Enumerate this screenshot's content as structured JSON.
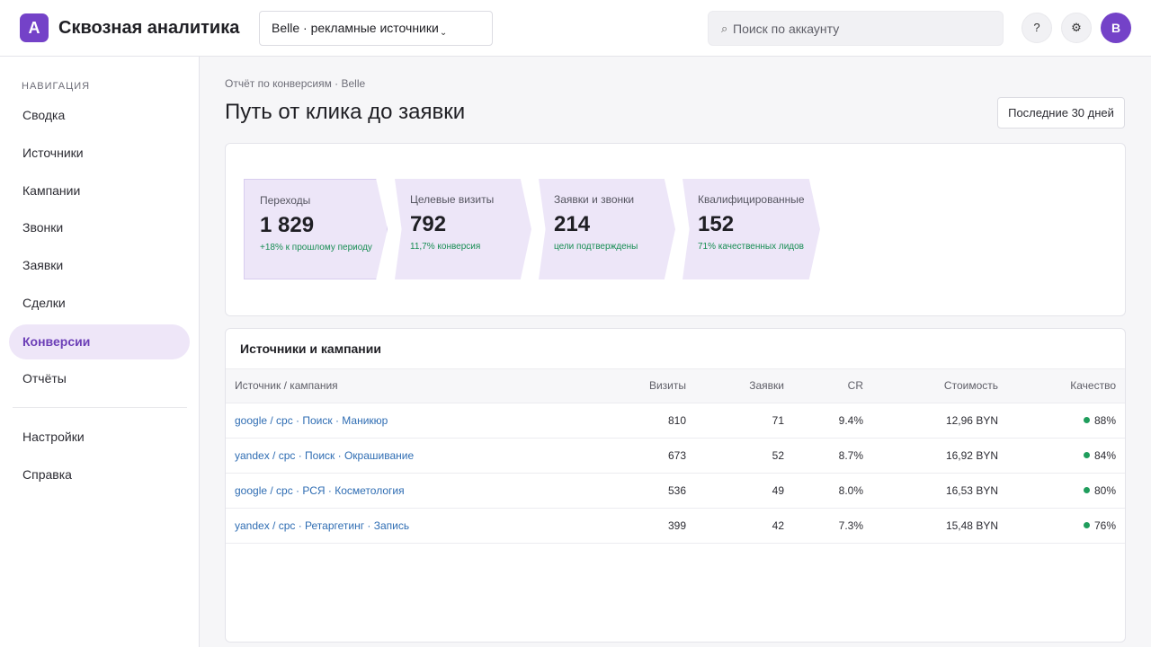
{
  "app": {
    "logo_letter": "A",
    "title": "Сквозная аналитика"
  },
  "header": {
    "account_select": "Belle · рекламные источники",
    "account_chevron": "⌄",
    "search_icon": "⌕",
    "search_placeholder": "Поиск по аккаунту",
    "help_label": "?",
    "settings_label": "⚙",
    "avatar_letter": "B",
    "accent_color": "#7442c8"
  },
  "sidebar": {
    "heading": "НАВИГАЦИЯ",
    "items": [
      {
        "label": "Сводка"
      },
      {
        "label": "Источники"
      },
      {
        "label": "Кампании"
      },
      {
        "label": "Звонки"
      },
      {
        "label": "Заявки"
      },
      {
        "label": "Сделки"
      },
      {
        "label": "Конверсии",
        "active": true
      },
      {
        "label": "Отчёты"
      }
    ],
    "bottom_items": [
      {
        "label": "Настройки"
      },
      {
        "label": "Справка"
      }
    ]
  },
  "main": {
    "breadcrumb": "Отчёт по конверсиям · Belle",
    "title": "Путь от клика до заявки",
    "period_button": "Последние 30 дней"
  },
  "funnel": {
    "stages": [
      {
        "label": "Переходы",
        "value": "1 829",
        "note": "+18% к прошлому периоду"
      },
      {
        "label": "Целевые визиты",
        "value": "792",
        "note": "11,7% конверсия"
      },
      {
        "label": "Заявки и звонки",
        "value": "214",
        "note": "цели подтверждены"
      },
      {
        "label": "Квалифицированные",
        "value": "152",
        "note": "71% качественных лидов"
      }
    ]
  },
  "table": {
    "title": "Источники и кампании",
    "columns": {
      "source": "Источник / кампания",
      "visits": "Визиты",
      "leads": "Заявки",
      "cr": "CR",
      "cost": "Стоимость",
      "quality": "Качество"
    },
    "rows": [
      {
        "source": "google / cpc · Поиск · Маникюр",
        "visits": "810",
        "leads": "71",
        "cr": "9.4%",
        "cost": "12,96 BYN",
        "quality": "88%"
      },
      {
        "source": "yandex / cpc · Поиск · Окрашивание",
        "visits": "673",
        "leads": "52",
        "cr": "8.7%",
        "cost": "16,92 BYN",
        "quality": "84%"
      },
      {
        "source": "google / cpc · РСЯ · Косметология",
        "visits": "536",
        "leads": "49",
        "cr": "8.0%",
        "cost": "16,53 BYN",
        "quality": "80%"
      },
      {
        "source": "yandex / cpc · Ретаргетинг · Запись",
        "visits": "399",
        "leads": "42",
        "cr": "7.3%",
        "cost": "15,48 BYN",
        "quality": "76%"
      }
    ],
    "quality_color": "#1f9d5c"
  }
}
